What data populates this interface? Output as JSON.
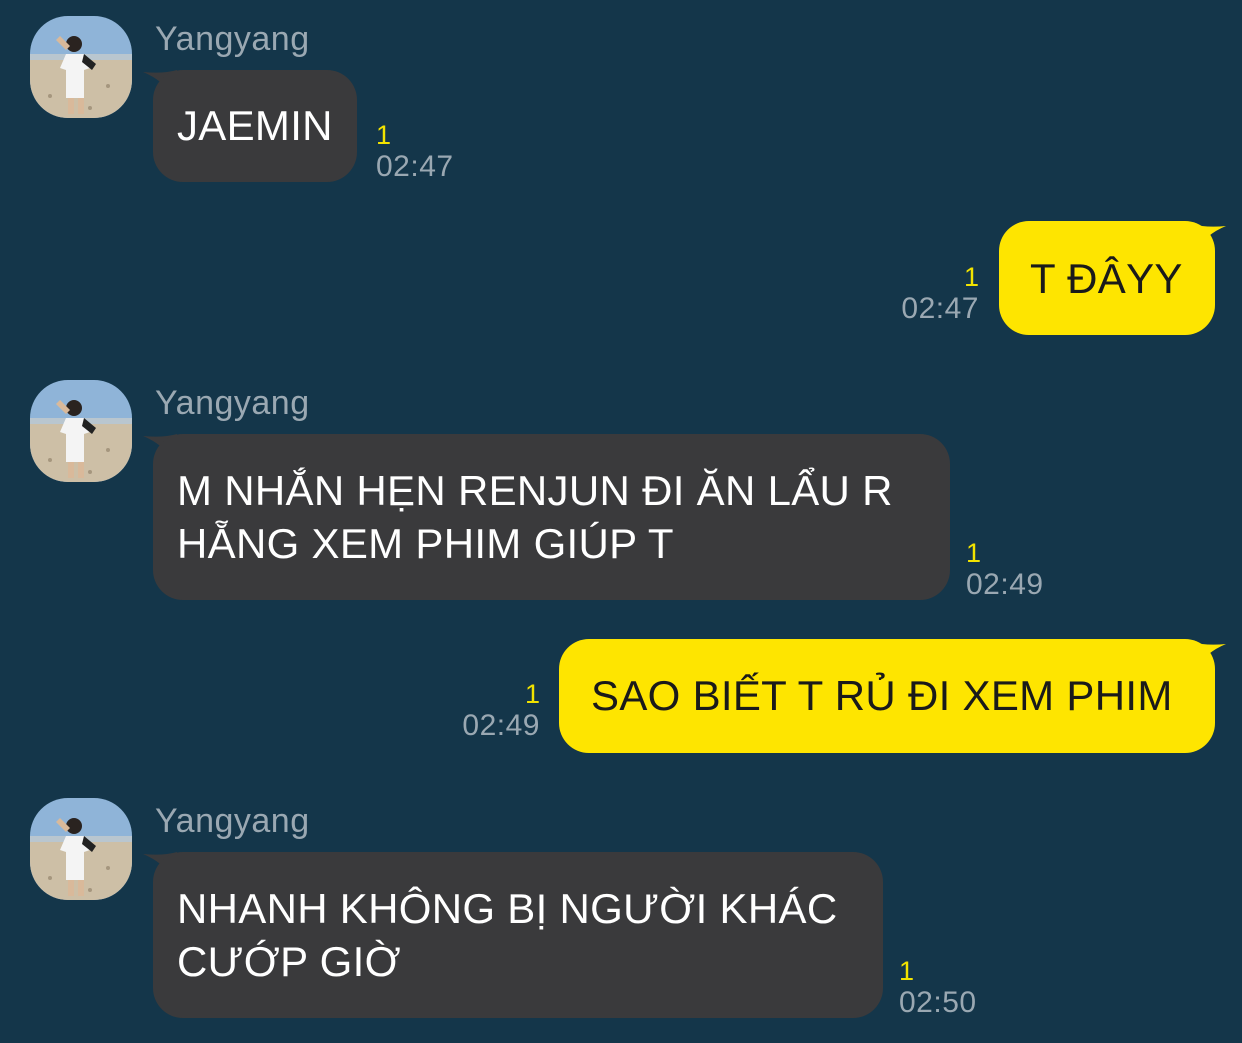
{
  "messages": [
    {
      "direction": "in",
      "sender": "Yangyang",
      "lines": [
        "JAEMIN"
      ],
      "unread": "1",
      "time": "02:47"
    },
    {
      "direction": "out",
      "lines": [
        "T ĐÂYY"
      ],
      "unread": "1",
      "time": "02:47"
    },
    {
      "direction": "in",
      "sender": "Yangyang",
      "lines": [
        "M NHẮN HẸN RENJUN ĐI ĂN LẨU R",
        "HẴNG XEM PHIM GIÚP T"
      ],
      "unread": "1",
      "time": "02:49"
    },
    {
      "direction": "out",
      "lines": [
        "SAO BIẾT T RỦ ĐI XEM PHIM"
      ],
      "unread": "1",
      "time": "02:49"
    },
    {
      "direction": "in",
      "sender": "Yangyang",
      "lines": [
        "NHANH KHÔNG BỊ NGƯỜI KHÁC",
        "CƯỚP GIỜ"
      ],
      "unread": "1",
      "time": "02:50"
    }
  ],
  "colors": {
    "background": "#14364a",
    "incoming_bubble": "#3a3a3c",
    "outgoing_bubble": "#fee500",
    "unread_count": "#f2e300",
    "timestamp": "#9aa8b2"
  },
  "icons": {
    "avatar": "profile-photo-avatar"
  }
}
